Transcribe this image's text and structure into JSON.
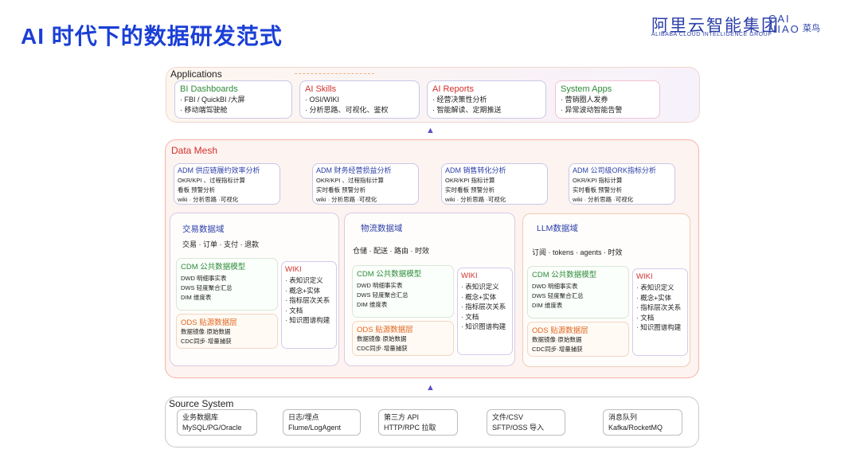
{
  "header": {
    "title": "AI 时代下的数据研发范式",
    "logo1_cn": "阿里云智能集团",
    "logo1_en": "ALIBABA CLOUD INTELLIGENCE GROUP",
    "logo2_line1": "CAI",
    "logo2_line2": "NIAO",
    "logo2_cn": "菜鸟"
  },
  "applications": {
    "label": "Applications",
    "cards": [
      {
        "title": "BI Dashboards",
        "color": "#2e8b3a",
        "lines": [
          "· FBI / QuickBI /大屏",
          "· 移动端驾驶舱"
        ]
      },
      {
        "title": "AI Skills",
        "color": "#d0312d",
        "lines": [
          "· OSI/WIKI",
          "· 分析思路、可视化、鉴权"
        ]
      },
      {
        "title": "AI Reports",
        "color": "#d0312d",
        "lines": [
          "· 经营决策性分析",
          "· 智能解读、定期推送"
        ]
      },
      {
        "title": "System Apps",
        "color": "#2e8b3a",
        "lines": [
          "· 营销圈人发券",
          "· 异常波动智能告警"
        ]
      }
    ]
  },
  "data_mesh": {
    "label": "Data Mesh",
    "adm_cards": [
      {
        "title": "ADM 供应链履约效率分析",
        "lines": [
          "OKR/KPI 、过程指标计算",
          "看板 预警分析",
          "wiki · 分析思路 ·可视化"
        ]
      },
      {
        "title": "ADM 财务经营损益分析",
        "lines": [
          "OKR/KPI 、过程指标计算",
          "实时看板 预警分析",
          "wiki · 分析思路 ·可视化"
        ]
      },
      {
        "title": "ADM 销售转化分析",
        "lines": [
          "OKR/KPI 指标计算",
          "实时看板 预警分析",
          "wiki · 分析思路 ·可视化"
        ]
      },
      {
        "title": "ADM 公司级ORK指标分析",
        "lines": [
          "OKR/KPI 指标计算",
          "实时看板 预警分析",
          "wiki · 分析思路 ·可视化"
        ]
      }
    ],
    "domains": [
      {
        "title": "交易数据域",
        "subtitle": "交易 · 订单 · 支付 · 退款",
        "cdm_title": "CDM 公共数据模型",
        "cdm_lines": [
          "DWD 明细事实表",
          "DWS 轻度聚合汇总",
          "DIM 维度表"
        ],
        "ods_title": "ODS 贴源数据层",
        "ods_lines": [
          "数据镜像·原始数据",
          "CDC同步·增量捕获"
        ],
        "wiki_title": "WIKI",
        "wiki_lines": [
          "· 表知识定义",
          "· 概念+实体",
          "· 指标层次关系",
          "· 文档",
          "· 知识图谱构建"
        ]
      },
      {
        "title": "物流数据域",
        "subtitle": "仓储 · 配送 · 路由 · 时效",
        "cdm_title": "CDM 公共数据模型",
        "cdm_lines": [
          "DWD 明细事实表",
          "DWS 轻度聚合汇总",
          "DIM 维度表"
        ],
        "ods_title": "ODS 贴源数据层",
        "ods_lines": [
          "数据镜像·原始数据",
          "CDC同步·增量捕获"
        ],
        "wiki_title": "WIKI",
        "wiki_lines": [
          "· 表知识定义",
          "· 概念+实体",
          "· 指标层次关系",
          "· 文档",
          "· 知识图谱构建"
        ]
      },
      {
        "title": "LLM数据域",
        "subtitle": "订阅 · tokens · agents · 时效",
        "cdm_title": "CDM 公共数据模型",
        "cdm_lines": [
          "DWD 明细事实表",
          "DWS 轻度聚合汇总",
          "DIM 维度表"
        ],
        "ods_title": "ODS 贴源数据层",
        "ods_lines": [
          "数据镜像·原始数据",
          "CDC同步·增量捕获"
        ],
        "wiki_title": "WIKI",
        "wiki_lines": [
          "· 表知识定义",
          "· 概念+实体",
          "· 指标层次关系",
          "· 文档",
          "· 知识图谱构建"
        ]
      }
    ]
  },
  "source_system": {
    "label": "Source System",
    "cards": [
      {
        "lines": [
          "业务数据库",
          "MySQL/PG/Oracle"
        ]
      },
      {
        "lines": [
          "日志/埋点",
          "Flume/LogAgent"
        ]
      },
      {
        "lines": [
          "第三方 API",
          "HTTP/RPC 拉取"
        ]
      },
      {
        "lines": [
          "文件/CSV",
          "SFTP/OSS 导入"
        ]
      },
      {
        "lines": [
          "消息队列",
          "Kafka/RocketMQ"
        ]
      }
    ]
  },
  "colors": {
    "title_blue": "#1a3fd6",
    "cdm_green": "#2e8b3a",
    "ods_orange": "#e0661f",
    "wiki_red": "#d0312d",
    "adm_blue": "#2b3ea8"
  }
}
